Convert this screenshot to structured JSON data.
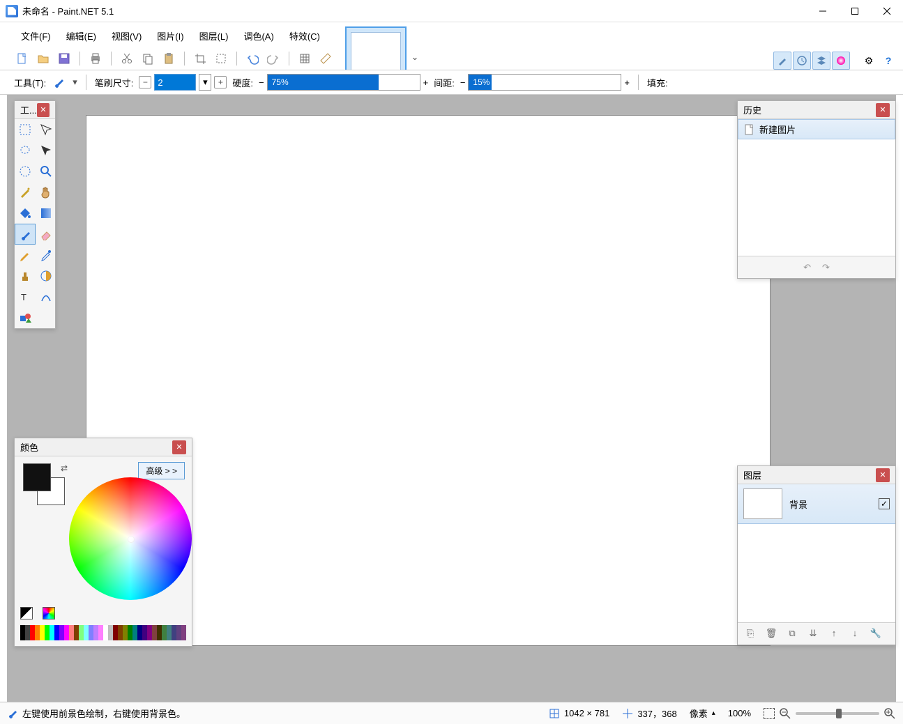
{
  "title": "未命名 - Paint.NET 5.1",
  "menus": {
    "file": "文件(F)",
    "edit": "编辑(E)",
    "view": "视图(V)",
    "image": "图片(I)",
    "layer": "图层(L)",
    "adjust": "调色(A)",
    "effects": "特效(C)"
  },
  "optbar": {
    "tool_label": "工具(T):",
    "brush_label": "笔刷尺寸:",
    "brush_value": "2",
    "hardness_label": "硬度:",
    "hardness_value": "75%",
    "spacing_label": "间距:",
    "spacing_value": "15%",
    "fill_label": "填充:"
  },
  "tools_panel": {
    "title": "工..."
  },
  "history_panel": {
    "title": "历史",
    "items": [
      "新建图片"
    ]
  },
  "layers_panel": {
    "title": "图层",
    "layer_name": "背景"
  },
  "colors_panel": {
    "title": "颜色",
    "advanced": "高级 > >"
  },
  "status": {
    "hint": "左键使用前景色绘制，右键使用背景色。",
    "dims": "1042 × 781",
    "cursor": "337，368",
    "units": "像素",
    "zoom": "100%"
  },
  "palette": [
    "#000",
    "#404040",
    "#ff0000",
    "#ff7f00",
    "#ffff00",
    "#00ff00",
    "#00ffff",
    "#0000ff",
    "#7f00ff",
    "#ff00ff",
    "#ff7f7f",
    "#7f3f00",
    "#7fff7f",
    "#7fffff",
    "#7f7fff",
    "#bf7fff",
    "#ff7fff",
    "#fff",
    "#c0c0c0",
    "#800000",
    "#804000",
    "#808000",
    "#008000",
    "#008080",
    "#000080",
    "#400080",
    "#800080",
    "#804040",
    "#403000",
    "#408040",
    "#408080",
    "#404080",
    "#604080",
    "#804080"
  ]
}
